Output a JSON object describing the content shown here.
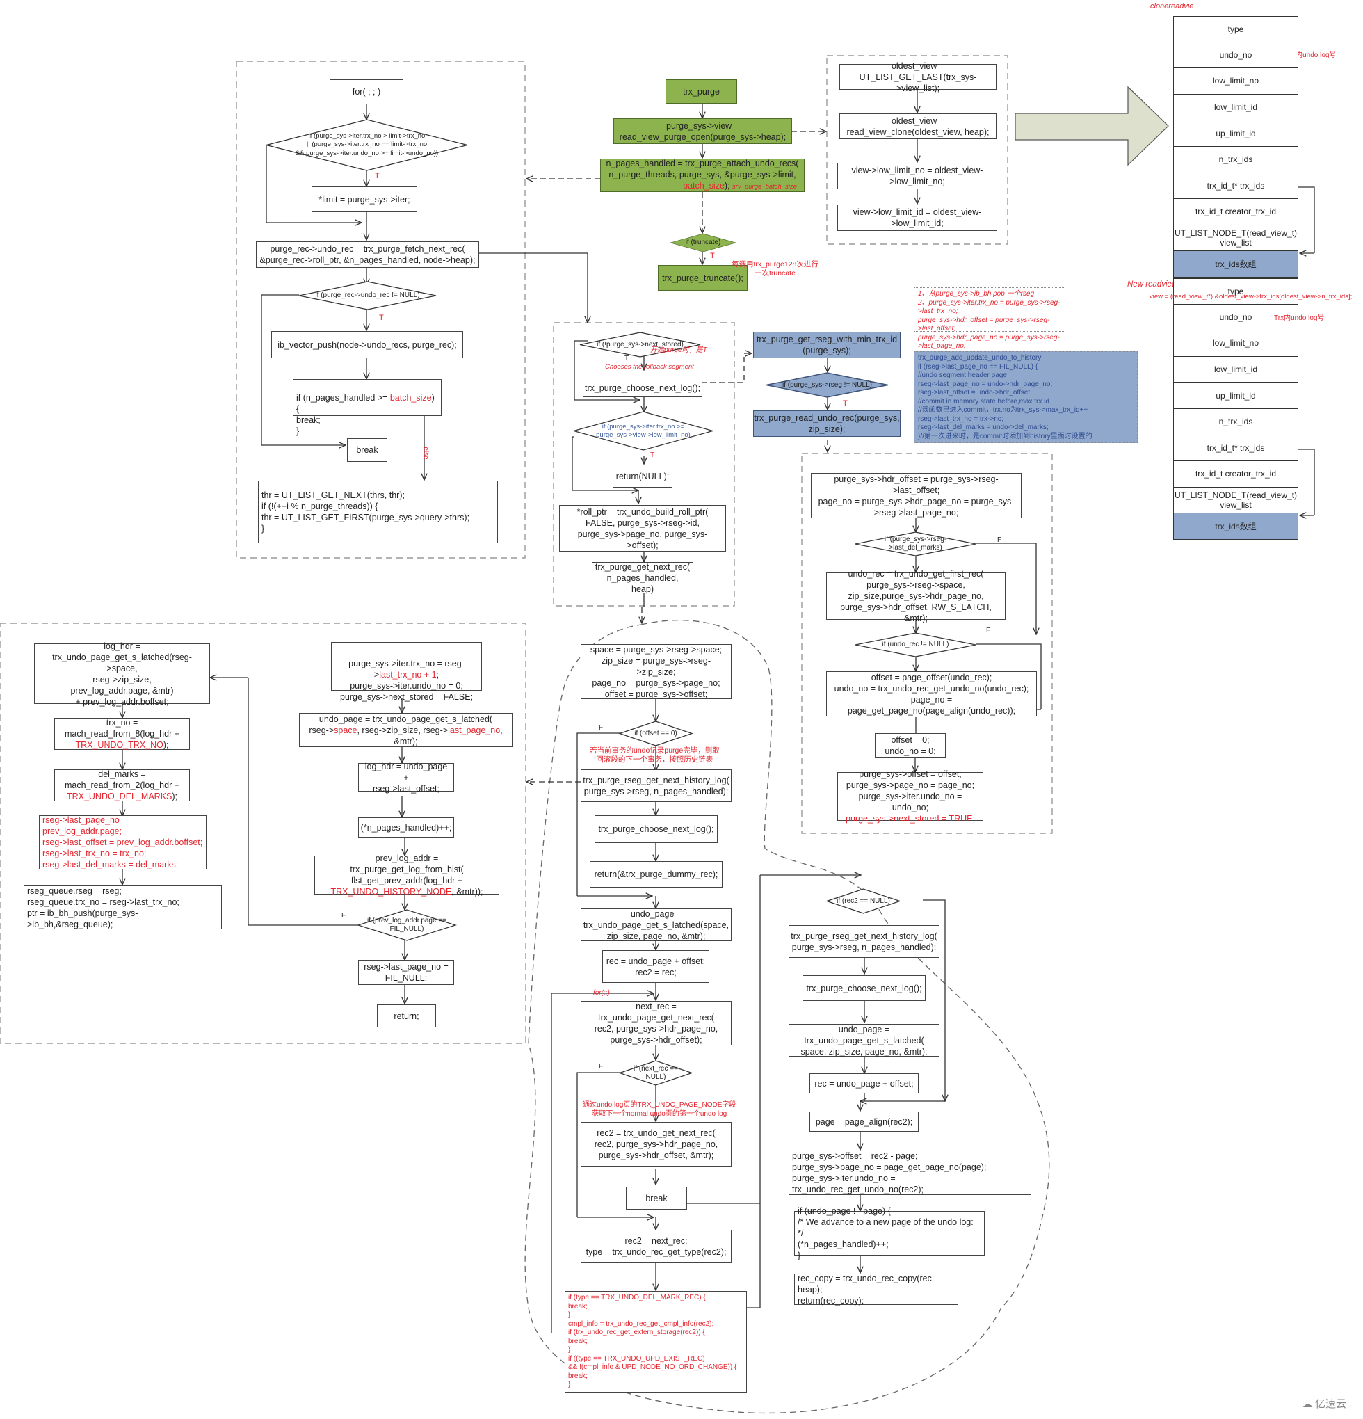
{
  "colors": {
    "green_fill": "#8db34e",
    "blue_fill": "#8fa8cc",
    "annotation_red": "#e3262f",
    "note_blue": "#2f4b8f",
    "arrow_fill": "#dde0cc"
  },
  "main": {
    "trx_purge": "trx_purge",
    "view_open": "purge_sys->view =\nread_view_purge_open(purge_sys->heap);",
    "attach_undo_recs": "n_pages_handled = trx_purge_attach_undo_recs(\nn_purge_threads, purge_sys, &purge_sys->limit,",
    "attach_batch_size": "batch_size",
    "attach_tail": ");",
    "attach_note": "srv_purge_batch_size",
    "if_truncate": "if (truncate)",
    "truncate_true": "T",
    "truncate": "trx_purge_truncate();",
    "truncate_note": "每调用trx_purge128次进行\n一次truncate"
  },
  "view_clone": {
    "get_last": "oldest_view =\nUT_LIST_GET_LAST(trx_sys->view_list);",
    "clone": "oldest_view =\nread_view_clone(oldest_view, heap);",
    "low_limit_no": "view->low_limit_no = oldest_view-\n>low_limit_no;",
    "low_limit_id": "view->low_limit_id = oldest_view-\n>low_limit_id;"
  },
  "attach_loop": {
    "for": "for( ; ; )",
    "if_limit": "if (purge_sys->iter.trx_no > limit->trx_no\n|| (purge_sys->iter.trx_no == limit->trx_no\n&& purge_sys->iter.undo_no >= limit->undo_no))",
    "if_limit_true": "T",
    "set_limit": "*limit = purge_sys->iter;",
    "fetch_next_rec": "purge_rec->undo_rec = trx_purge_fetch_next_rec(\n&purge_rec->roll_ptr, &n_pages_handled, node->heap);",
    "if_undo_rec": "if (purge_rec->undo_rec != NULL)",
    "if_undo_rec_true": "T",
    "vector_push": "ib_vector_push(node->undo_recs, purge_rec);",
    "if_batch_pre": "if (n_pages_handled >= ",
    "if_batch_var": "batch_size",
    "if_batch_post": ") {\n   break;\n}",
    "break": "break",
    "else_label": "else",
    "next_thr": "thr = UT_LIST_GET_NEXT(thrs, thr);\nif (!(++i % n_purge_threads)) {\n              thr = UT_LIST_GET_FIRST(purge_sys->query->thrs);\n}"
  },
  "fetch_next_rec": {
    "if_next_stored": "if (!purge_sys->next_stored)",
    "next_stored_note": "开始purge时，是T",
    "next_stored_true": "T",
    "choose_note": "Chooses the rollback segment\nwith the smallest trx_id",
    "choose_next_log": "trx_purge_choose_next_log();",
    "if_low_limit": "if (purge_sys->iter.trx_no >=\npurge_sys->view->low_limit_no)",
    "if_low_limit_true": "T",
    "return_null": "return(NULL);",
    "build_roll_ptr": "*roll_ptr = trx_undo_build_roll_ptr(\nFALSE, purge_sys->rseg->id,\npurge_sys->page_no, purge_sys->offset);",
    "get_next_rec": "trx_purge_get_next_rec(\nn_pages_handled, heap)"
  },
  "choose_next_log": {
    "get_rseg": "trx_purge_get_rseg_with_min_trx_id\n(purge_sys);",
    "if_rseg": "if (purge_sys->rseg != NULL)",
    "if_rseg_true": "T",
    "read_undo_rec": "trx_purge_read_undo_rec(purge_sys,\nzip_size);"
  },
  "notes": {
    "rseg_note": "1、从purge_sys->ib_bh pop 一个rseg\n2、purge_sys->iter.trx_no = purge_sys->rseg->last_trx_no;\n   purge_sys->hdr_offset = purge_sys->rseg->last_offset;\n   purge_sys->hdr_page_no = purge_sys->rseg->last_page_no;",
    "history_note": "trx_purge_add_update_undo_to_history\n   if (rseg->last_page_no == FIL_NULL) {\n                    //undo segment header page\n                    rseg->last_page_no = undo->hdr_page_no;\n                    rseg->last_offset = undo->hdr_offset;\n                    //commit in memory state before,max trx id\n                    //该函数已进入commit，trx.no为trx_sys->max_trx_id++\n                    rseg->last_trx_no = trx->no;\n                    rseg->last_del_marks = undo->del_marks;\n}//第一次进来时，是commit时添加到history里面时设置的"
  },
  "read_undo_rec": {
    "hdr_offset": "purge_sys->hdr_offset = purge_sys->rseg->last_offset;\npage_no = purge_sys->hdr_page_no = purge_sys-\n>rseg->last_page_no;",
    "if_del_marks": "if (purge_sys->rseg-\n>last_del_marks)",
    "if_del_marks_false": "F",
    "get_first_rec": "undo_rec = trx_undo_get_first_rec(\npurge_sys->rseg->space,\nzip_size,purge_sys->hdr_page_no,\npurge_sys->hdr_offset, RW_S_LATCH, &mtr);",
    "if_undo_rec": "if (undo_rec != NULL)",
    "if_undo_rec_false": "F",
    "offsets": "offset = page_offset(undo_rec);\nundo_no = trx_undo_rec_get_undo_no(undo_rec);\npage_no = page_get_page_no(page_align(undo_rec));",
    "zero": "offset = 0;\nundo_no = 0;",
    "store": "purge_sys->offset = offset;\npurge_sys->page_no = page_no;\npurge_sys->iter.undo_no = undo_no;",
    "store_red": "purge_sys->next_stored = TRUE;"
  },
  "history_log": {
    "log_hdr": "log_hdr =\ntrx_undo_page_get_s_latched(rseg->space,\nrseg->zip_size,\nprev_log_addr.page, &mtr)\n+ prev_log_addr.boffset;",
    "trx_no_pre": "trx_no =\nmach_read_from_8(log_hdr +",
    "trx_no_red": "TRX_UNDO_TRX_NO",
    "trx_no_post": ");",
    "del_marks_pre": "del_marks =\nmach_read_from_2(log_hdr +",
    "del_marks_red": "TRX_UNDO_DEL_MARKS",
    "del_marks_post": ");",
    "rseg_update": "rseg->last_page_no = prev_log_addr.page;\nrseg->last_offset = prev_log_addr.boffset;\nrseg->last_trx_no = trx_no;\nrseg->last_del_marks = del_marks;",
    "bh_push": "rseg_queue.rseg = rseg;\nrseg_queue.trx_no = rseg->last_trx_no;\nptr = ib_bh_push(purge_sys->ib_bh,&rseg_queue);",
    "iter_pre": "purge_sys->iter.trx_no = rseg-\n>",
    "iter_red": "last_trx_no + 1",
    "iter_post": ";\npurge_sys->iter.undo_no = 0;\npurge_sys->next_stored = FALSE;",
    "undo_page_l1": "undo_page = trx_undo_page_get_s_latched(",
    "undo_page_a": "rseg->",
    "undo_page_b": "space",
    "undo_page_c": ", rseg->zip_size, rseg->",
    "undo_page_d": "last_page_no",
    "undo_page_e": ", &mtr);",
    "log_hdr2": "log_hdr = undo_page +\nrseg->last_offset;",
    "pages_inc": "(*n_pages_handled)++;",
    "prev_addr_pre": "prev_log_addr = trx_purge_get_log_from_hist(\nflst_get_prev_addr(log_hdr +",
    "prev_addr_red": "TRX_UNDO_HISTORY_NODE",
    "prev_addr_post": ", &mtr));",
    "if_fil_null": "if (prev_log_addr.page ==\nFIL_NULL)",
    "if_fil_null_false": "F",
    "set_fil_null": "rseg->last_page_no =\nFIL_NULL;",
    "return": "return;"
  },
  "get_next_rec": {
    "init": "space = purge_sys->rseg->space;\nzip_size = purge_sys->rseg->zip_size;\npage_no = purge_sys->page_no;\noffset = purge_sys->offset;",
    "if_offset": "if (offset == 0)",
    "if_offset_false": "F",
    "offset_note": "若当前事务的undo记录purge完毕，则取\n回滚段的下一个事务，按照历史链表",
    "next_history": "trx_purge_rseg_get_next_history_log(\npurge_sys->rseg, n_pages_handled);",
    "choose_next": "trx_purge_choose_next_log();",
    "return_dummy": "return(&trx_purge_dummy_rec);",
    "undo_page": "undo_page =\ntrx_undo_page_get_s_latched(space,\nzip_size, page_no, &mtr);",
    "rec_init": "rec = undo_page + offset;\nrec2 = rec;",
    "for_label": "for(;;)",
    "next_rec": "next_rec =\ntrx_undo_page_get_next_rec(\nrec2, purge_sys->hdr_page_no,\npurge_sys->hdr_offset);",
    "if_next_null": "if (next_rec ==\nNULL)",
    "if_next_null_false": "F",
    "page_node_note": "通过undo log页的TRX_UNDO_PAGE_NODE字段\n获取下一个normal undo页的第一个undo log",
    "get_next_rec2": "rec2 = trx_undo_get_next_rec(\nrec2, purge_sys->hdr_page_no,\npurge_sys->hdr_offset, &mtr);",
    "break": "break",
    "rec2_next": "rec2 = next_rec;\ntype = trx_undo_rec_get_type(rec2);",
    "type_checks": "if (type == TRX_UNDO_DEL_MARK_REC) {\n   break;\n}\ncmpl_info = trx_undo_rec_get_cmpl_info(rec2);\nif (trx_undo_rec_get_extern_storage(rec2)) {\n   break;\n}\nif ((type == TRX_UNDO_UPD_EXIST_REC)\n   && !(cmpl_info & UPD_NODE_NO_ORD_CHANGE)) {\n   break;\n}",
    "if_rec2_null": "if (rec2 == NULL)",
    "next_history2": "trx_purge_rseg_get_next_history_log(\npurge_sys->rseg, n_pages_handled);",
    "choose_next2": "trx_purge_choose_next_log();",
    "undo_page2": "undo_page =\ntrx_undo_page_get_s_latched(\nspace, zip_size, page_no, &mtr);",
    "rec_offset": "rec = undo_page + offset;",
    "page_align": "page = page_align(rec2);",
    "store_offsets": "purge_sys->offset = rec2 - page;\npurge_sys->page_no = page_get_page_no(page);\npurge_sys->iter.undo_no = trx_undo_rec_get_undo_no(rec2);",
    "advance_page": "if (undo_page != page) {\n/* We advance to a new page of the undo log: */\n              (*n_pages_handled)++;\n}",
    "rec_copy": "rec_copy = trx_undo_rec_copy(rec, heap);\nreturn(rec_copy);"
  },
  "structs": {
    "clone_title": "clonereadvie",
    "new_title": "New readview",
    "new_view_expr": "view = (read_view_t*) &oldest_view->trx_ids[oldest_view->n_trx_ids];",
    "undo_no_note": "Trx内undo log号",
    "fields": [
      "type",
      "undo_no",
      "low_limit_no",
      "low_limit_id",
      "up_limit_id",
      "n_trx_ids",
      "trx_id_t*   trx_ids",
      "trx_id_t    creator_trx_id",
      "UT_LIST_NODE_T(read_view_t)\nview_list",
      "trx_ids数组"
    ]
  },
  "watermark": "亿速云"
}
